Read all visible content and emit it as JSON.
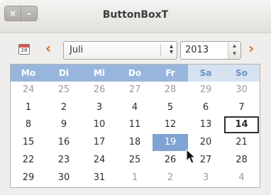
{
  "window": {
    "title": "ButtonBoxT",
    "close_glyph": "×",
    "minimize_glyph": "–"
  },
  "toolbar": {
    "calendar_icon_text": "28",
    "prev_arrow": "‹",
    "next_arrow": "›",
    "month_value": "Juli",
    "month_combo_arrows": "◇",
    "year_value": "2013",
    "year_up": "▲",
    "year_down": "▼"
  },
  "weekdays": [
    "Mo",
    "Di",
    "Mi",
    "Do",
    "Fr",
    "Sa",
    "So"
  ],
  "weeks": [
    [
      {
        "d": "24",
        "o": true
      },
      {
        "d": "25",
        "o": true
      },
      {
        "d": "26",
        "o": true
      },
      {
        "d": "27",
        "o": true
      },
      {
        "d": "28",
        "o": true
      },
      {
        "d": "29",
        "o": true
      },
      {
        "d": "30",
        "o": true
      }
    ],
    [
      {
        "d": "1"
      },
      {
        "d": "2"
      },
      {
        "d": "3"
      },
      {
        "d": "4"
      },
      {
        "d": "5"
      },
      {
        "d": "6"
      },
      {
        "d": "7"
      }
    ],
    [
      {
        "d": "8"
      },
      {
        "d": "9"
      },
      {
        "d": "10"
      },
      {
        "d": "11"
      },
      {
        "d": "12"
      },
      {
        "d": "13"
      },
      {
        "d": "14",
        "today": true
      }
    ],
    [
      {
        "d": "15"
      },
      {
        "d": "16"
      },
      {
        "d": "17"
      },
      {
        "d": "18"
      },
      {
        "d": "19",
        "selected": true
      },
      {
        "d": "20"
      },
      {
        "d": "21"
      }
    ],
    [
      {
        "d": "22"
      },
      {
        "d": "23"
      },
      {
        "d": "24"
      },
      {
        "d": "25"
      },
      {
        "d": "26"
      },
      {
        "d": "27"
      },
      {
        "d": "28"
      }
    ],
    [
      {
        "d": "29"
      },
      {
        "d": "30"
      },
      {
        "d": "31"
      },
      {
        "d": "1",
        "o": true
      },
      {
        "d": "2",
        "o": true
      },
      {
        "d": "3",
        "o": true
      },
      {
        "d": "4",
        "o": true
      }
    ]
  ],
  "colors": {
    "header_bg": "#98b6dd",
    "weekend_header_bg": "#d7e2f1",
    "selected_bg": "#7fa3d2",
    "nav_arrow": "#e06c1f"
  }
}
